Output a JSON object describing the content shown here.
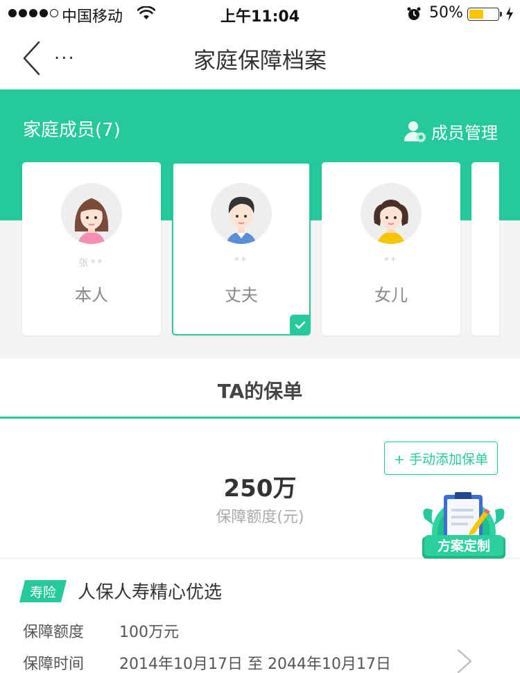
{
  "status_bar": {
    "carrier": "中国移动",
    "time": "上午11:04",
    "battery_percent": "50%",
    "battery_level": 0.5,
    "battery_color": "#f7c600"
  },
  "nav": {
    "more": "...",
    "title": "家庭保障档案"
  },
  "family": {
    "title": "家庭成员(7)",
    "manage_label": "成员管理",
    "members": [
      {
        "name": "张**",
        "role": "本人",
        "avatar": "woman-avatar",
        "selected": false
      },
      {
        "name": "**",
        "role": "丈夫",
        "avatar": "man-avatar",
        "selected": true
      },
      {
        "name": "**",
        "role": "女儿",
        "avatar": "girl-avatar",
        "selected": false
      }
    ]
  },
  "tab": {
    "label": "TA的保单"
  },
  "summary": {
    "add_policy": "+ 手动添加保单",
    "total_amount": "250万",
    "total_label": "保障额度(元)",
    "plan_badge": "方案定制"
  },
  "policy": {
    "tag": "寿险",
    "name": "人保人寿精心优选",
    "coverage_label": "保障额度",
    "coverage_value": "100万元",
    "period_label": "保障时间",
    "period_value": "2014年10月17日 至 2044年10月17日"
  },
  "colors": {
    "accent": "#26c99b",
    "background": "#f4f4f4"
  }
}
